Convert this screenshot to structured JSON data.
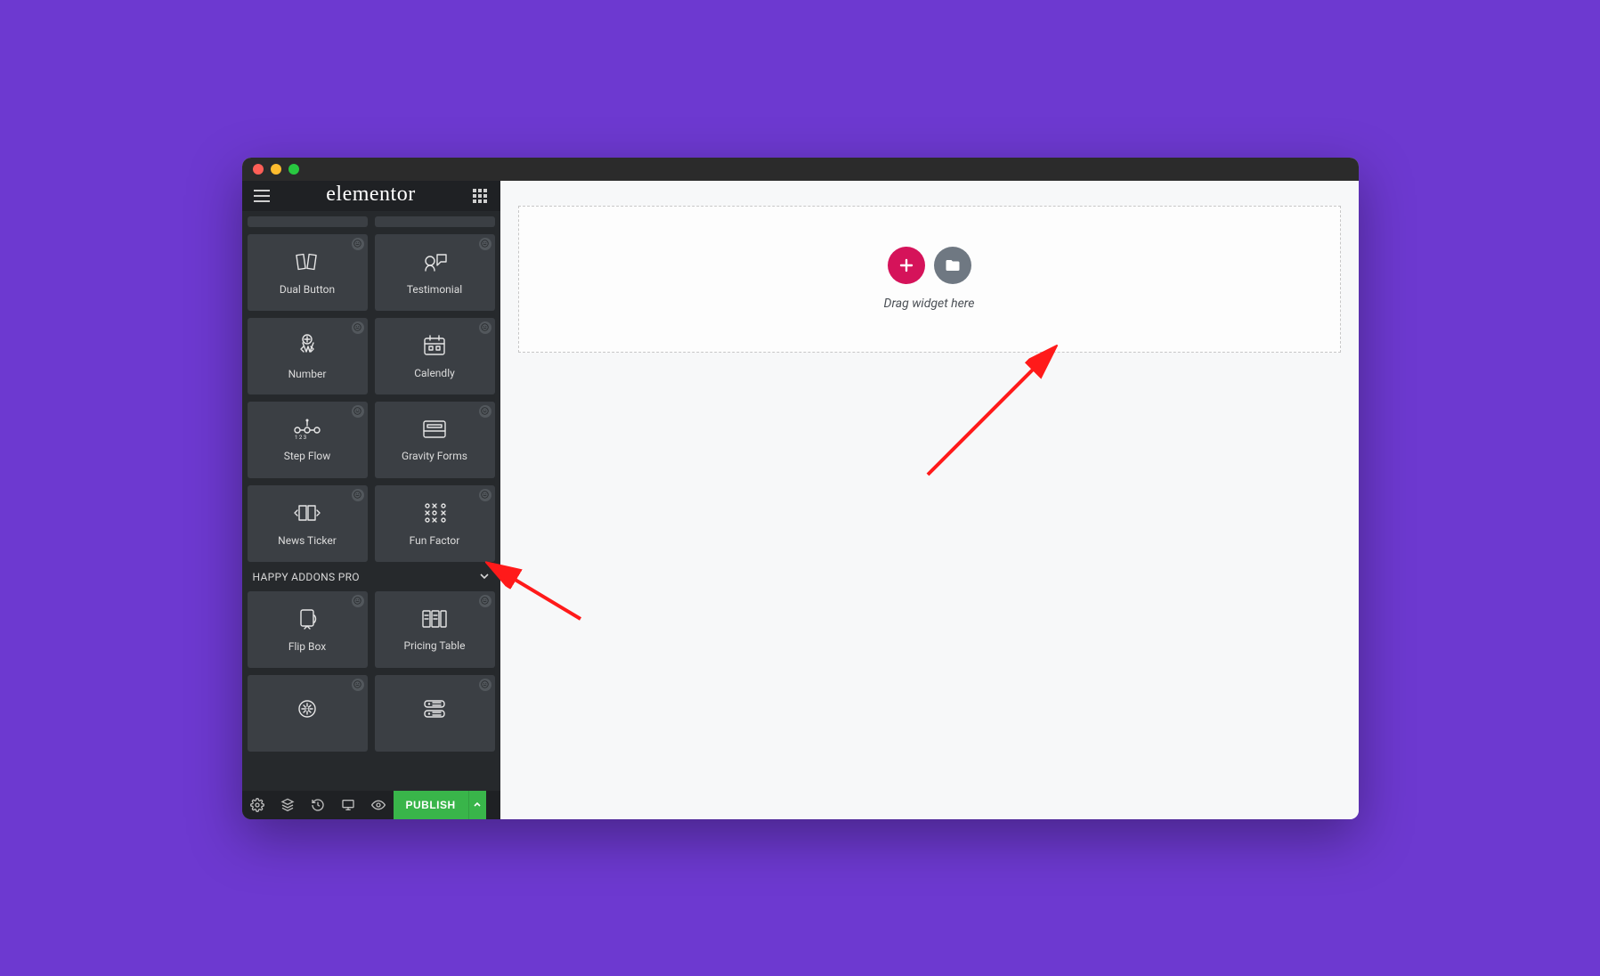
{
  "brand": "elementor",
  "sidebar": {
    "widgets_a": [
      {
        "label": "Dual Button",
        "icon": "dual-button"
      },
      {
        "label": "Testimonial",
        "icon": "testimonial"
      },
      {
        "label": "Number",
        "icon": "number"
      },
      {
        "label": "Calendly",
        "icon": "calendly"
      },
      {
        "label": "Step Flow",
        "icon": "step-flow"
      },
      {
        "label": "Gravity Forms",
        "icon": "gravity-forms"
      },
      {
        "label": "News Ticker",
        "icon": "news-ticker"
      },
      {
        "label": "Fun Factor",
        "icon": "fun-factor"
      }
    ],
    "section_b_title": "HAPPY ADDONS PRO",
    "widgets_b": [
      {
        "label": "Flip Box",
        "icon": "flip-box"
      },
      {
        "label": "Pricing Table",
        "icon": "pricing-table"
      },
      {
        "label": "",
        "icon": "generic-a"
      },
      {
        "label": "",
        "icon": "generic-b"
      }
    ]
  },
  "footer": {
    "publish_label": "PUBLISH"
  },
  "canvas": {
    "drop_text": "Drag widget here"
  }
}
